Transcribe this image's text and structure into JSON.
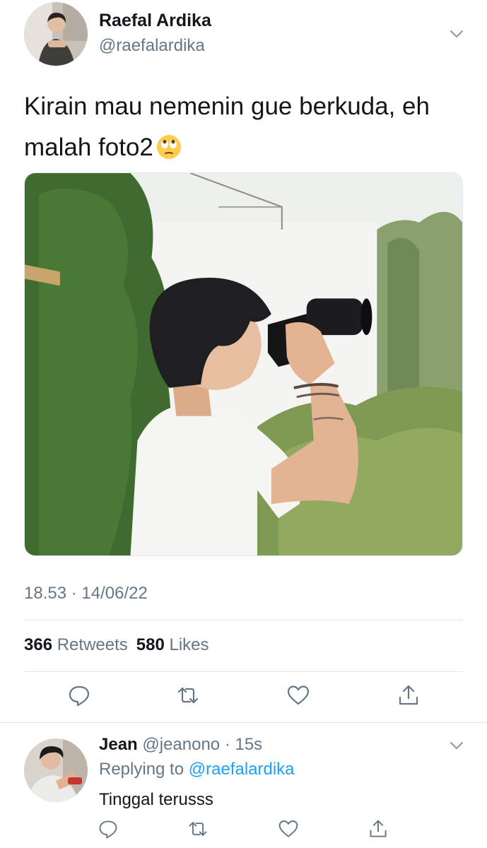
{
  "tweet": {
    "display_name": "Raefal Ardika",
    "handle": "@raefalardika",
    "text": "Kirain mau nemenin gue berkuda, eh malah foto2",
    "emoji": "face-with-rolling-eyes",
    "timestamp": "18.53 · 14/06/22",
    "retweets_count": "366",
    "retweets_label": "Retweets",
    "likes_count": "580",
    "likes_label": "Likes",
    "actions": [
      "reply-icon",
      "retweet-icon",
      "like-icon",
      "share-icon"
    ]
  },
  "reply": {
    "display_name": "Jean",
    "handle": "@jeanono",
    "separator": " · ",
    "time": "15s",
    "replying_prefix": "Replying to ",
    "replying_to": "@raefalardika",
    "text": "Tinggal terusss",
    "actions": [
      "reply-icon",
      "retweet-icon",
      "like-icon",
      "share-icon"
    ]
  },
  "colors": {
    "primary_text": "#14171a",
    "secondary_text": "#657786",
    "link": "#1da1f2",
    "divider": "#e1e8ed"
  }
}
